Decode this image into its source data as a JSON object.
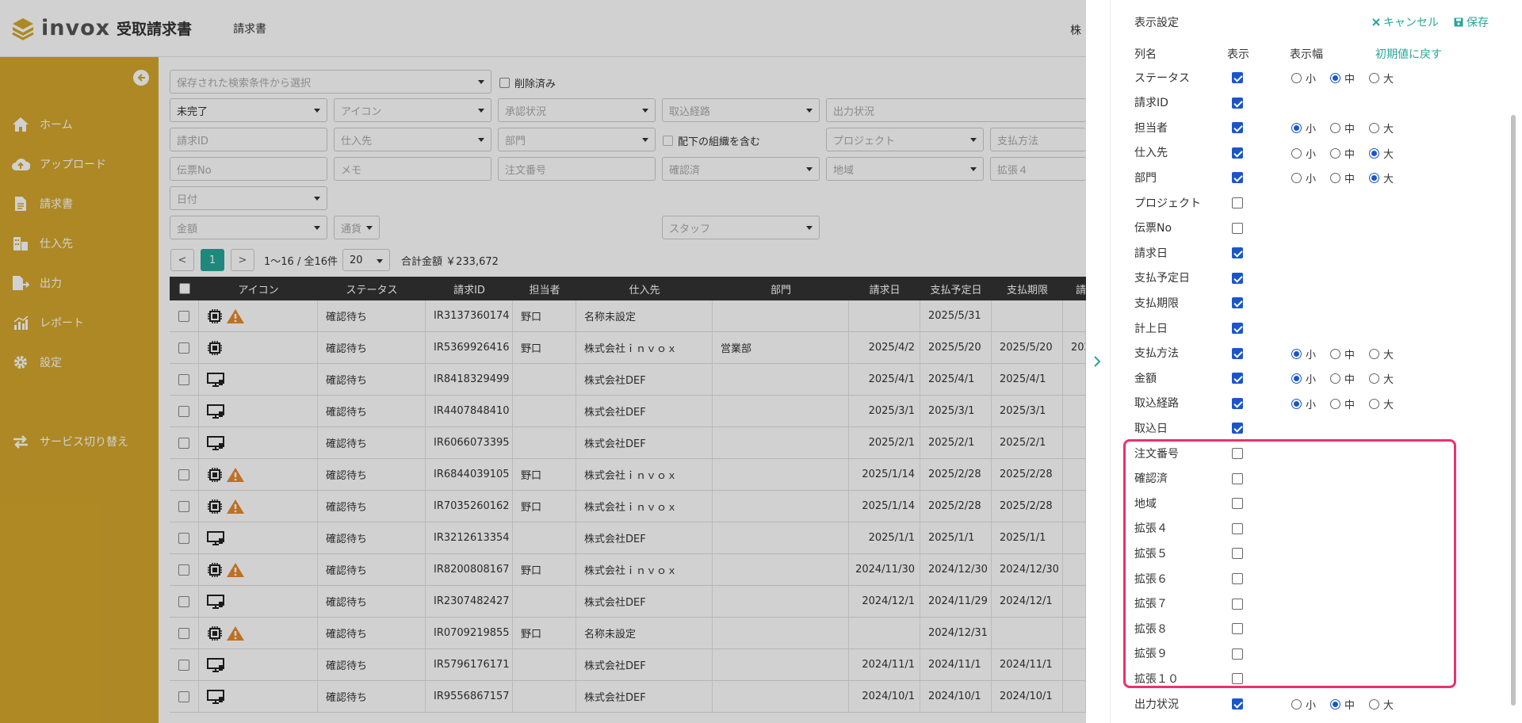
{
  "header": {
    "logo": "invox",
    "app_name": "受取請求書",
    "page": "請求書",
    "company": "株"
  },
  "sidebar": {
    "items": [
      {
        "label": "ホーム",
        "icon": "home-icon"
      },
      {
        "label": "アップロード",
        "icon": "cloud-upload-icon"
      },
      {
        "label": "請求書",
        "icon": "document-icon"
      },
      {
        "label": "仕入先",
        "icon": "building-icon"
      },
      {
        "label": "出力",
        "icon": "export-icon"
      },
      {
        "label": "レポート",
        "icon": "chart-icon"
      },
      {
        "label": "設定",
        "icon": "gear-icon"
      },
      {
        "label": "サービス切り替え",
        "icon": "switch-icon"
      }
    ]
  },
  "filters": {
    "saved_search": "保存された検索条件から選択",
    "deleted": "削除済み",
    "status": "未完了",
    "icon": "アイコン",
    "approval": "承認状況",
    "import_route": "取込経路",
    "output_status": "出力状況",
    "invoice_id": "請求ID",
    "supplier": "仕入先",
    "department": "部門",
    "include_sub_org": "配下の組織を含む",
    "project": "プロジェクト",
    "payment_method": "支払方法",
    "slip_no": "伝票No",
    "memo": "メモ",
    "order_no": "注文番号",
    "confirmed": "確認済",
    "region": "地域",
    "ext4": "拡張４",
    "date": "日付",
    "amount": "金額",
    "currency": "通貨",
    "staff": "スタッフ"
  },
  "pager": {
    "prev": "<",
    "current": "1",
    "next": ">",
    "range": "1〜16 / 全16件",
    "per_page": "20",
    "total": "合計金額 ￥233,672"
  },
  "table": {
    "columns": [
      "アイコン",
      "ステータス",
      "請求ID",
      "担当者",
      "仕入先",
      "部門",
      "請求日",
      "支払予定日",
      "支払期限",
      "請"
    ],
    "rows": [
      {
        "icon": "chip",
        "warn": true,
        "status": "確認待ち",
        "id": "IR3137360174",
        "staff": "野口",
        "supplier": "名称未設定",
        "dept": "",
        "inv_date": "",
        "pay_date": "2025/5/31",
        "due": "",
        "extra": ""
      },
      {
        "icon": "chip",
        "warn": false,
        "status": "確認待ち",
        "id": "IR5369926416",
        "staff": "野口",
        "supplier": "株式会社ｉｎｖｏｘ",
        "dept": "営業部",
        "inv_date": "2025/4/2",
        "pay_date": "2025/5/20",
        "due": "2025/5/20",
        "extra": "202"
      },
      {
        "icon": "monitor",
        "warn": false,
        "status": "確認待ち",
        "id": "IR8418329499",
        "staff": "",
        "supplier": "株式会社DEF",
        "dept": "",
        "inv_date": "2025/4/1",
        "pay_date": "2025/4/1",
        "due": "2025/4/1",
        "extra": ""
      },
      {
        "icon": "monitor",
        "warn": false,
        "status": "確認待ち",
        "id": "IR4407848410",
        "staff": "",
        "supplier": "株式会社DEF",
        "dept": "",
        "inv_date": "2025/3/1",
        "pay_date": "2025/3/1",
        "due": "2025/3/1",
        "extra": ""
      },
      {
        "icon": "monitor",
        "warn": false,
        "status": "確認待ち",
        "id": "IR6066073395",
        "staff": "",
        "supplier": "株式会社DEF",
        "dept": "",
        "inv_date": "2025/2/1",
        "pay_date": "2025/2/1",
        "due": "2025/2/1",
        "extra": ""
      },
      {
        "icon": "chip",
        "warn": true,
        "status": "確認待ち",
        "id": "IR6844039105",
        "staff": "野口",
        "supplier": "株式会社ｉｎｖｏｘ",
        "dept": "",
        "inv_date": "2025/1/14",
        "pay_date": "2025/2/28",
        "due": "2025/2/28",
        "extra": ""
      },
      {
        "icon": "chip",
        "warn": true,
        "status": "確認待ち",
        "id": "IR7035260162",
        "staff": "野口",
        "supplier": "株式会社ｉｎｖｏｘ",
        "dept": "",
        "inv_date": "2025/1/14",
        "pay_date": "2025/2/28",
        "due": "2025/2/28",
        "extra": ""
      },
      {
        "icon": "monitor",
        "warn": false,
        "status": "確認待ち",
        "id": "IR3212613354",
        "staff": "",
        "supplier": "株式会社DEF",
        "dept": "",
        "inv_date": "2025/1/1",
        "pay_date": "2025/1/1",
        "due": "2025/1/1",
        "extra": ""
      },
      {
        "icon": "chip",
        "warn": true,
        "status": "確認待ち",
        "id": "IR8200808167",
        "staff": "野口",
        "supplier": "株式会社ｉｎｖｏｘ",
        "dept": "",
        "inv_date": "2024/11/30",
        "pay_date": "2024/12/30",
        "due": "2024/12/30",
        "extra": ""
      },
      {
        "icon": "monitor",
        "warn": false,
        "status": "確認待ち",
        "id": "IR2307482427",
        "staff": "",
        "supplier": "株式会社DEF",
        "dept": "",
        "inv_date": "2024/12/1",
        "pay_date": "2024/11/29",
        "due": "2024/12/1",
        "extra": ""
      },
      {
        "icon": "chip",
        "warn": true,
        "status": "確認待ち",
        "id": "IR0709219855",
        "staff": "野口",
        "supplier": "名称未設定",
        "dept": "",
        "inv_date": "",
        "pay_date": "2024/12/31",
        "due": "",
        "extra": ""
      },
      {
        "icon": "monitor",
        "warn": false,
        "status": "確認待ち",
        "id": "IR5796176171",
        "staff": "",
        "supplier": "株式会社DEF",
        "dept": "",
        "inv_date": "2024/11/1",
        "pay_date": "2024/11/1",
        "due": "2024/11/1",
        "extra": ""
      },
      {
        "icon": "monitor",
        "warn": false,
        "status": "確認待ち",
        "id": "IR9556867157",
        "staff": "",
        "supplier": "株式会社DEF",
        "dept": "",
        "inv_date": "2024/10/1",
        "pay_date": "2024/10/1",
        "due": "2024/10/1",
        "extra": ""
      }
    ]
  },
  "panel": {
    "title": "表示設定",
    "cancel": "キャンセル",
    "save": "保存",
    "col_name": "列名",
    "col_show": "表示",
    "col_width": "表示幅",
    "reset": "初期値に戻す",
    "sizes": [
      "小",
      "中",
      "大"
    ],
    "rows": [
      {
        "name": "ステータス",
        "show": true,
        "width": 1
      },
      {
        "name": "請求ID",
        "show": true,
        "width": -1
      },
      {
        "name": "担当者",
        "show": true,
        "width": 0
      },
      {
        "name": "仕入先",
        "show": true,
        "width": 2
      },
      {
        "name": "部門",
        "show": true,
        "width": 2
      },
      {
        "name": "プロジェクト",
        "show": false,
        "width": -1
      },
      {
        "name": "伝票No",
        "show": false,
        "width": -1
      },
      {
        "name": "請求日",
        "show": true,
        "width": -1
      },
      {
        "name": "支払予定日",
        "show": true,
        "width": -1
      },
      {
        "name": "支払期限",
        "show": true,
        "width": -1
      },
      {
        "name": "計上日",
        "show": true,
        "width": -1
      },
      {
        "name": "支払方法",
        "show": true,
        "width": 0
      },
      {
        "name": "金額",
        "show": true,
        "width": 0
      },
      {
        "name": "取込経路",
        "show": true,
        "width": 0
      },
      {
        "name": "取込日",
        "show": true,
        "width": -1
      },
      {
        "name": "注文番号",
        "show": false,
        "width": -1
      },
      {
        "name": "確認済",
        "show": false,
        "width": -1
      },
      {
        "name": "地域",
        "show": false,
        "width": -1
      },
      {
        "name": "拡張４",
        "show": false,
        "width": -1
      },
      {
        "name": "拡張５",
        "show": false,
        "width": -1
      },
      {
        "name": "拡張６",
        "show": false,
        "width": -1
      },
      {
        "name": "拡張７",
        "show": false,
        "width": -1
      },
      {
        "name": "拡張８",
        "show": false,
        "width": -1
      },
      {
        "name": "拡張９",
        "show": false,
        "width": -1
      },
      {
        "name": "拡張１０",
        "show": false,
        "width": -1
      },
      {
        "name": "出力状況",
        "show": true,
        "width": 1
      }
    ]
  },
  "colors": {
    "sidebar": "#d4a72c",
    "accent": "#26a69a",
    "check": "#1a56c8",
    "highlight": "#e8336b",
    "warn": "#e8892b"
  }
}
